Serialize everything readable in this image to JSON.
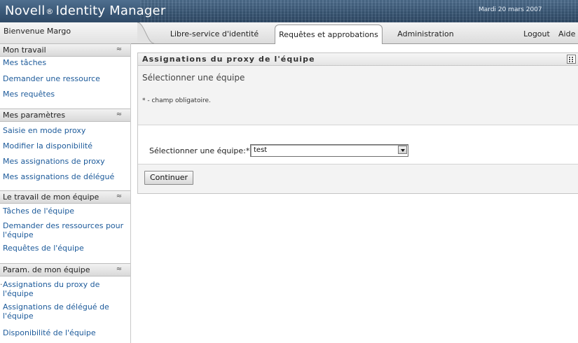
{
  "header": {
    "brand_name": "Novell",
    "brand_mark": "®",
    "brand_product": "Identity Manager",
    "date": "Mardi 20 mars 2007"
  },
  "tabbar": {
    "welcome": "Bienvenue Margo",
    "tabs": [
      {
        "label": "Libre-service d'identité",
        "active": false
      },
      {
        "label": "Requêtes et approbations",
        "active": true
      },
      {
        "label": "Administration",
        "active": false
      }
    ],
    "logout": "Logout",
    "help": "Aide"
  },
  "sidebar": {
    "sections": [
      {
        "title": "Mon travail",
        "items": [
          "Mes tâches",
          "Demander une ressource",
          "Mes requêtes"
        ]
      },
      {
        "title": "Mes paramètres",
        "items": [
          "Saisie en mode proxy",
          "Modifier la disponibilité",
          "Mes assignations de proxy",
          "Mes assignations de délégué"
        ]
      },
      {
        "title": "Le travail de mon équipe",
        "items": [
          "Tâches de l'équipe",
          "Demander des ressources pour l'équipe",
          "Requêtes de l'équipe"
        ]
      },
      {
        "title": "Param. de mon équipe",
        "items": [
          "Assignations du proxy de l'équipe",
          "Assignations de délégué de l'équipe",
          "Disponibilité de l'équipe"
        ]
      }
    ],
    "collapse_glyph": "≈",
    "current_item": "Assignations du proxy de l'équipe",
    "bullet": "·"
  },
  "main": {
    "title": "Assignations du proxy de l'équipe",
    "heading": "Sélectionner une équipe",
    "required_note": "* - champ obligatoire.",
    "field_label": "Sélectionner une équipe:*",
    "select_value": "test",
    "continue_label": "Continuer"
  }
}
